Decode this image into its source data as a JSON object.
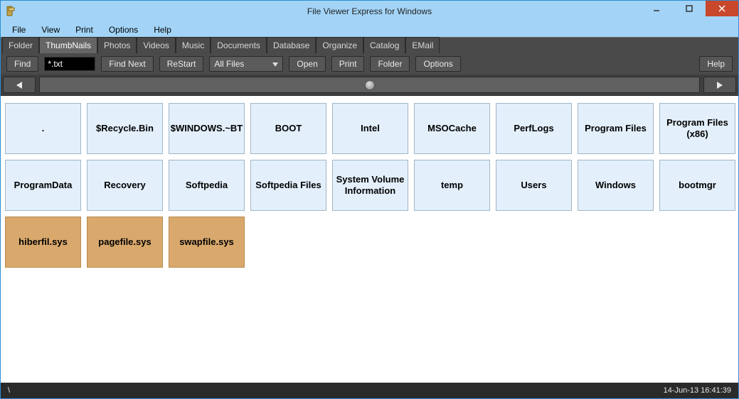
{
  "window": {
    "title": "File Viewer Express for Windows"
  },
  "menubar": [
    "File",
    "View",
    "Print",
    "Options",
    "Help"
  ],
  "tabs": [
    "Folder",
    "ThumbNails",
    "Photos",
    "Videos",
    "Music",
    "Documents",
    "Database",
    "Organize",
    "Catalog",
    "EMail"
  ],
  "active_tab_index": 1,
  "toolbar": {
    "find": "Find",
    "search_value": "*.txt",
    "find_next": "Find Next",
    "restart": "ReStart",
    "filter_selected": "All Files",
    "open": "Open",
    "print": "Print",
    "folder": "Folder",
    "options": "Options",
    "help": "Help"
  },
  "tiles": [
    {
      "label": ".",
      "type": "folder"
    },
    {
      "label": "$Recycle.Bin",
      "type": "folder"
    },
    {
      "label": "$WINDOWS.~BT",
      "type": "folder"
    },
    {
      "label": "BOOT",
      "type": "folder"
    },
    {
      "label": "Intel",
      "type": "folder"
    },
    {
      "label": "MSOCache",
      "type": "folder"
    },
    {
      "label": "PerfLogs",
      "type": "folder"
    },
    {
      "label": "Program Files",
      "type": "folder"
    },
    {
      "label": "Program Files (x86)",
      "type": "folder"
    },
    {
      "label": "ProgramData",
      "type": "folder"
    },
    {
      "label": "Recovery",
      "type": "folder"
    },
    {
      "label": "Softpedia",
      "type": "folder"
    },
    {
      "label": "Softpedia Files",
      "type": "folder"
    },
    {
      "label": "System Volume Information",
      "type": "folder"
    },
    {
      "label": "temp",
      "type": "folder"
    },
    {
      "label": "Users",
      "type": "folder"
    },
    {
      "label": "Windows",
      "type": "folder"
    },
    {
      "label": "bootmgr",
      "type": "folder"
    },
    {
      "label": "hiberfil.sys",
      "type": "file"
    },
    {
      "label": "pagefile.sys",
      "type": "file"
    },
    {
      "label": "swapfile.sys",
      "type": "file"
    }
  ],
  "status": {
    "path": "\\",
    "datetime": "14-Jun-13  16:41:39"
  }
}
